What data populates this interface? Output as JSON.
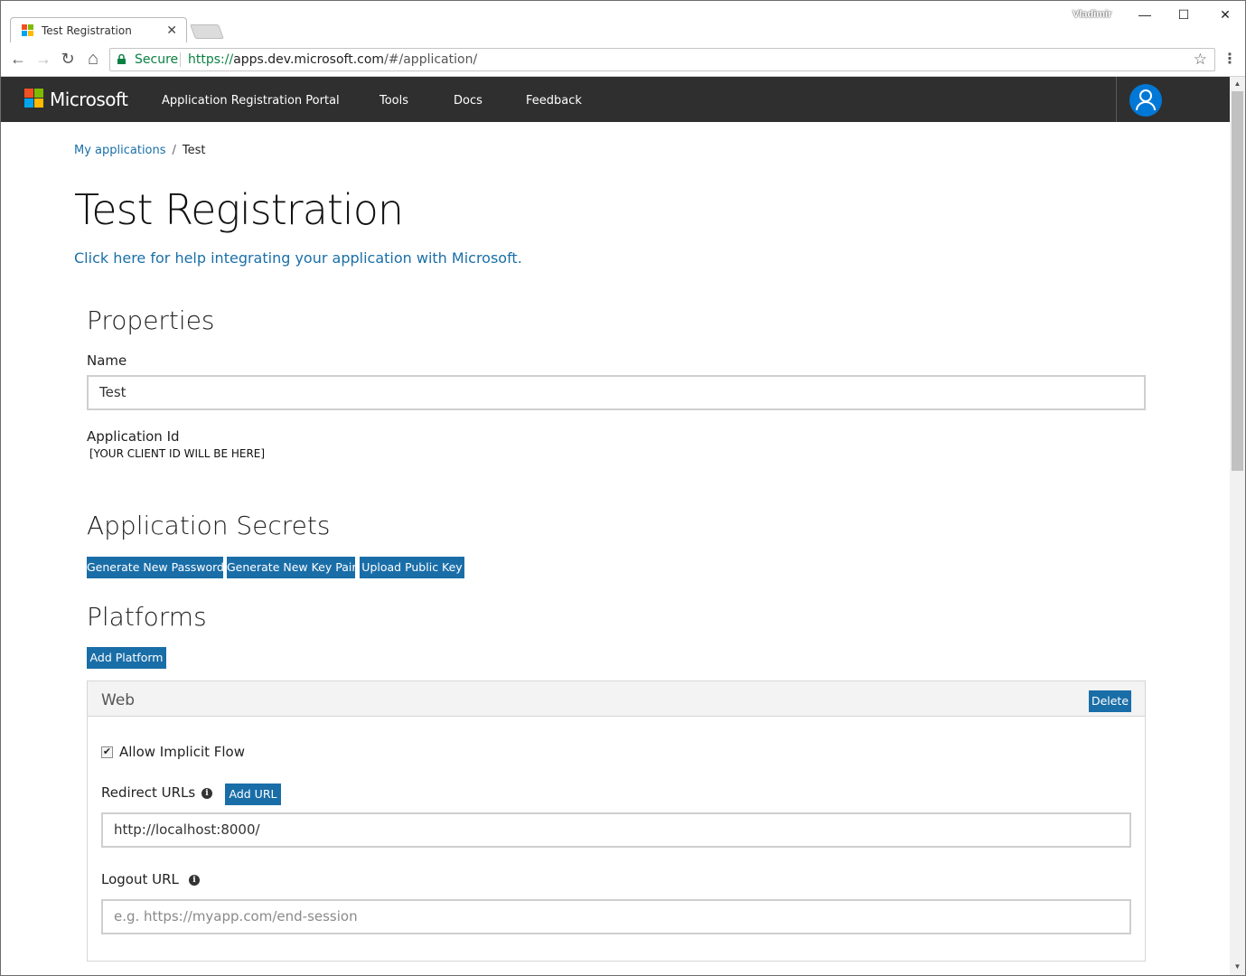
{
  "browser": {
    "tab_title": "Test Registration",
    "tab_close": "✕",
    "user_name": "Vladimir",
    "window_controls": {
      "minimize": "—",
      "maximize": "☐",
      "close": "✕"
    },
    "back": "←",
    "forward": "→",
    "reload": "↻",
    "home": "⌂",
    "secure_label": "Secure",
    "url_scheme": "https://",
    "url_host": "apps.dev.microsoft.com",
    "url_path": "/#/application/",
    "bookmark_star": "☆",
    "menu": "⋮"
  },
  "header": {
    "brand": "Microsoft",
    "nav": {
      "portal": "Application Registration Portal",
      "tools": "Tools",
      "docs": "Docs",
      "feedback": "Feedback"
    },
    "logo_colors": [
      "#f25022",
      "#7fba00",
      "#00a4ef",
      "#ffb900"
    ],
    "avatar_color": "#0078d7"
  },
  "breadcrumb": {
    "parent": "My applications",
    "separator": "/",
    "current": "Test"
  },
  "page": {
    "title": "Test Registration",
    "help_link": "Click here for help integrating your application with Microsoft."
  },
  "properties": {
    "heading": "Properties",
    "name_label": "Name",
    "name_value": "Test",
    "app_id_label": "Application Id",
    "app_id_value": "[YOUR CLIENT ID WILL BE HERE]"
  },
  "secrets": {
    "heading": "Application Secrets",
    "buttons": {
      "generate_password": "Generate New Password",
      "generate_key_pair": "Generate New Key Pair",
      "upload_public_key": "Upload Public Key"
    }
  },
  "platforms": {
    "heading": "Platforms",
    "add_platform": "Add Platform",
    "web": {
      "title": "Web",
      "delete": "Delete",
      "allow_implicit_flow_label": "Allow Implicit Flow",
      "allow_implicit_flow_checked": true,
      "checkmark": "✔",
      "redirect_label": "Redirect URLs",
      "info_glyph": "i",
      "add_url": "Add URL",
      "redirect_value": "http://localhost:8000/",
      "logout_label": "Logout URL",
      "logout_placeholder": "e.g. https://myapp.com/end-session"
    }
  },
  "colors": {
    "accent": "#1a6ea8",
    "link": "#1a6fa8",
    "header_bg": "#2f2f2f",
    "secure_green": "#0b8043"
  }
}
